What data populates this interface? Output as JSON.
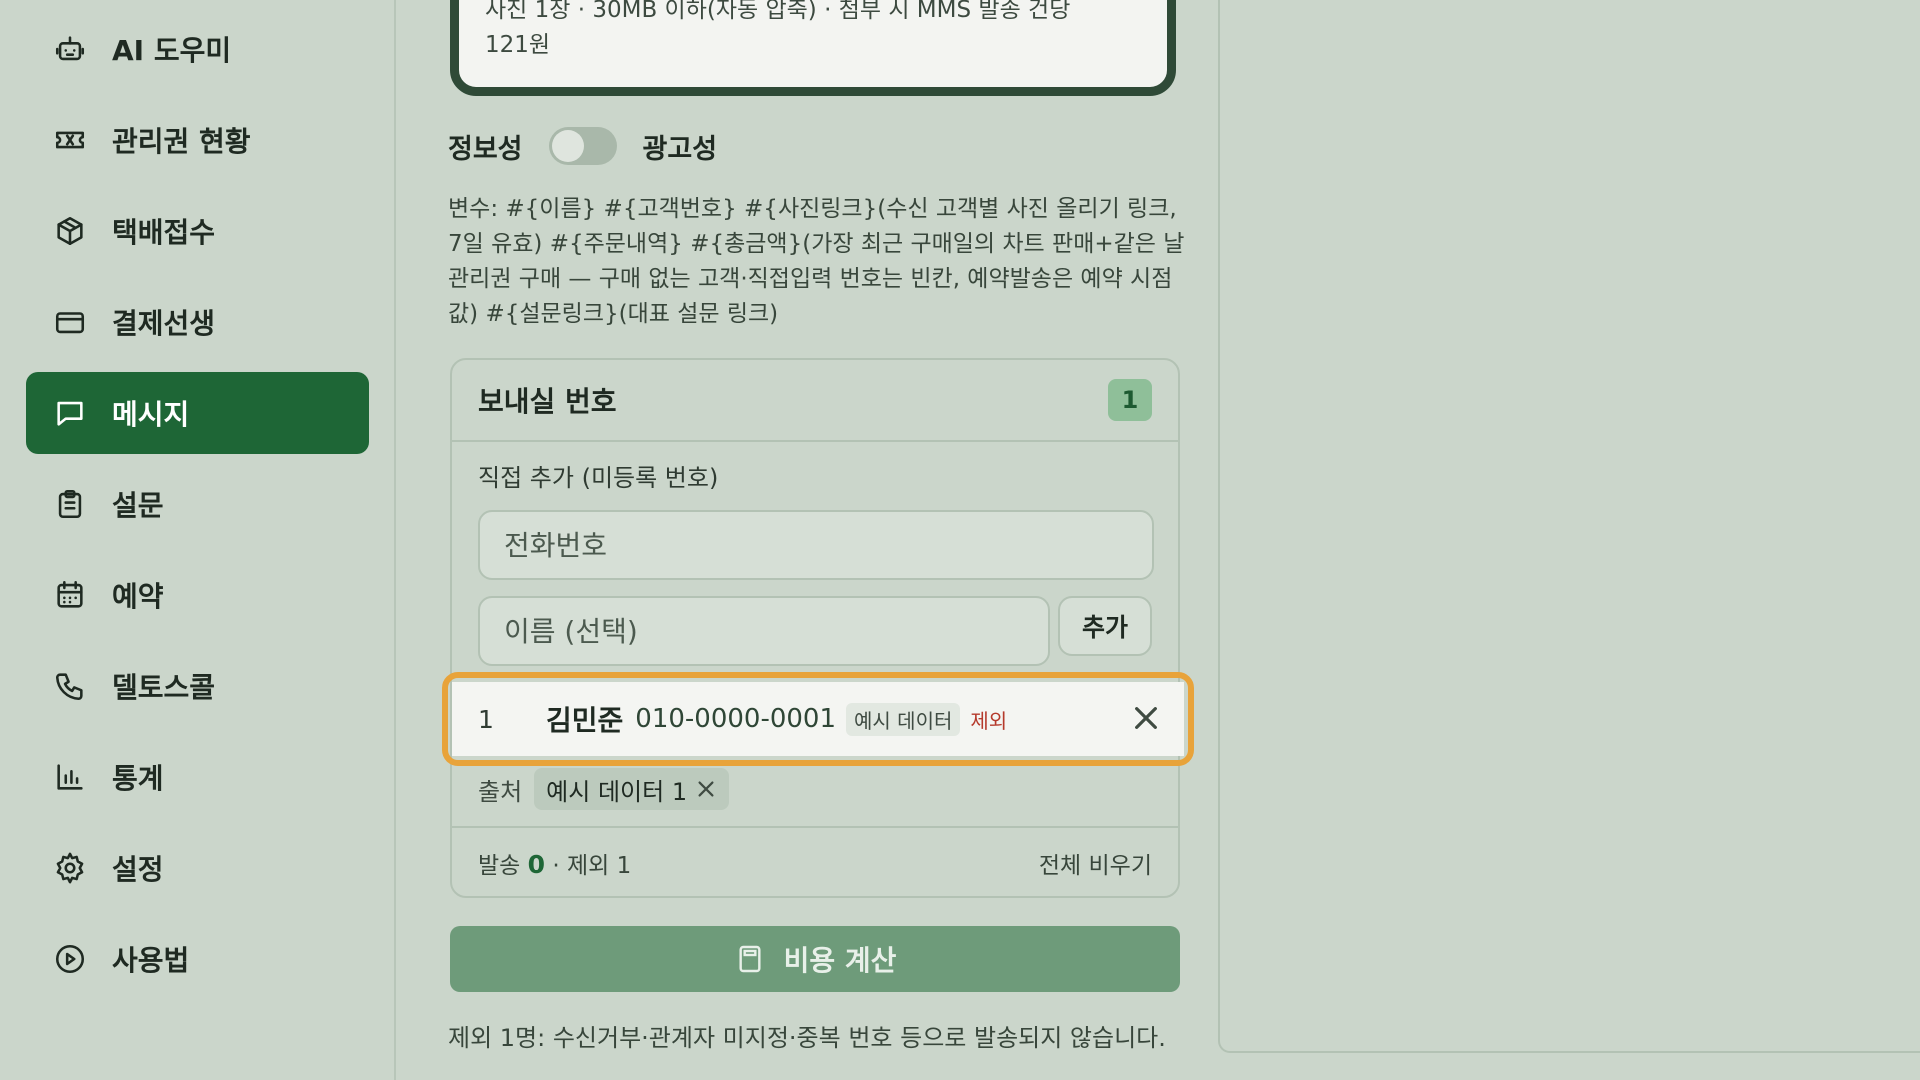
{
  "sidebar": {
    "items": [
      {
        "label": "AI 도우미",
        "icon": "robot-icon",
        "active": false
      },
      {
        "label": "관리권 현황",
        "icon": "ticket-icon",
        "active": false
      },
      {
        "label": "택배접수",
        "icon": "package-icon",
        "active": false
      },
      {
        "label": "결제선생",
        "icon": "credit-card-icon",
        "active": false
      },
      {
        "label": "메시지",
        "icon": "message-icon",
        "active": true
      },
      {
        "label": "설문",
        "icon": "clipboard-icon",
        "active": false
      },
      {
        "label": "예약",
        "icon": "calendar-icon",
        "active": false
      },
      {
        "label": "델토스콜",
        "icon": "phone-icon",
        "active": false
      },
      {
        "label": "통계",
        "icon": "bar-chart-icon",
        "active": false
      },
      {
        "label": "설정",
        "icon": "gear-icon",
        "active": false
      },
      {
        "label": "사용법",
        "icon": "play-circle-icon",
        "active": false
      }
    ]
  },
  "preview": {
    "line1": "사진 1장 · 30MB 이하(자동 압축) · 첨부 시 MMS 발송 건당",
    "line2": "121원"
  },
  "toggle": {
    "left_label": "정보성",
    "right_label": "광고성",
    "is_ad": false
  },
  "variables_text": "변수: #{이름} #{고객번호} #{사진링크}(수신 고객별 사진 올리기 링크, 7일 유효) #{주문내역} #{총금액}(가장 최근 구매일의 차트 판매+같은 날 관리권 구매 — 구매 없는 고객·직접입력 번호는 빈칸, 예약발송은 예약 시점 값) #{설문링크}(대표 설문 링크)",
  "recipients": {
    "title": "보내실 번호",
    "count": "1",
    "direct_add_label": "직접 추가 (미등록 번호)",
    "phone_placeholder": "전화번호",
    "name_placeholder": "이름 (선택)",
    "add_button": "추가",
    "rows": [
      {
        "num": "1",
        "name": "김민준",
        "phone": "010-0000-0001",
        "tag": "예시 데이터",
        "excluded_label": "제외"
      }
    ],
    "source_label": "출처",
    "source_chip": "예시 데이터 1",
    "stats_send_label": "발송",
    "stats_send_count": "0",
    "stats_excluded": "· 제외 1",
    "clear_all": "전체 비우기"
  },
  "cost_button": "비용 계산",
  "exclusion_note": "제외 1명: 수신거부·관계자 미지정·중복 번호 등으로 발송되지 않습니다.",
  "colors": {
    "background": "#cbd6cb",
    "accent": "#1e6636",
    "highlight": "#e8a33a",
    "excluded": "#b53a2c"
  }
}
